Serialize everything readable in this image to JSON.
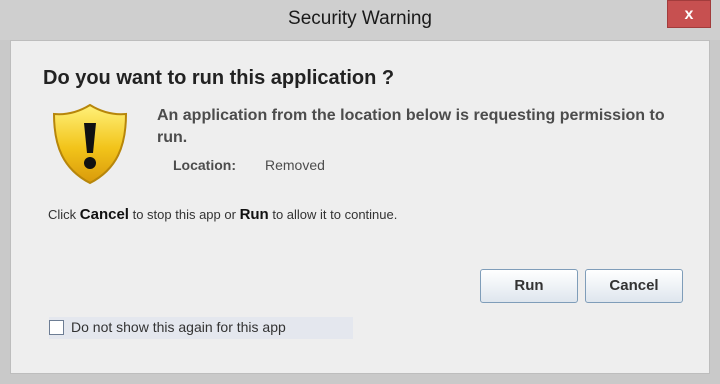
{
  "window": {
    "title": "Security Warning",
    "close_label": "x"
  },
  "dialog": {
    "heading": "Do you want to run this application ?",
    "message": "An application from the location below is requesting permission to run.",
    "location_label": "Location:",
    "location_value": "Removed",
    "instruction_prefix": "Click ",
    "instruction_cancel": "Cancel",
    "instruction_middle": " to stop this app or ",
    "instruction_run": "Run",
    "instruction_suffix": " to allow it to continue.",
    "run_label": "Run",
    "cancel_label": "Cancel",
    "checkbox_label": "Do not show this again for this app",
    "checkbox_checked": false
  },
  "icons": {
    "warning": "warning-shield-icon",
    "close": "close-icon"
  },
  "colors": {
    "shield_fill": "#f2c41a",
    "close_button": "#c75050"
  }
}
